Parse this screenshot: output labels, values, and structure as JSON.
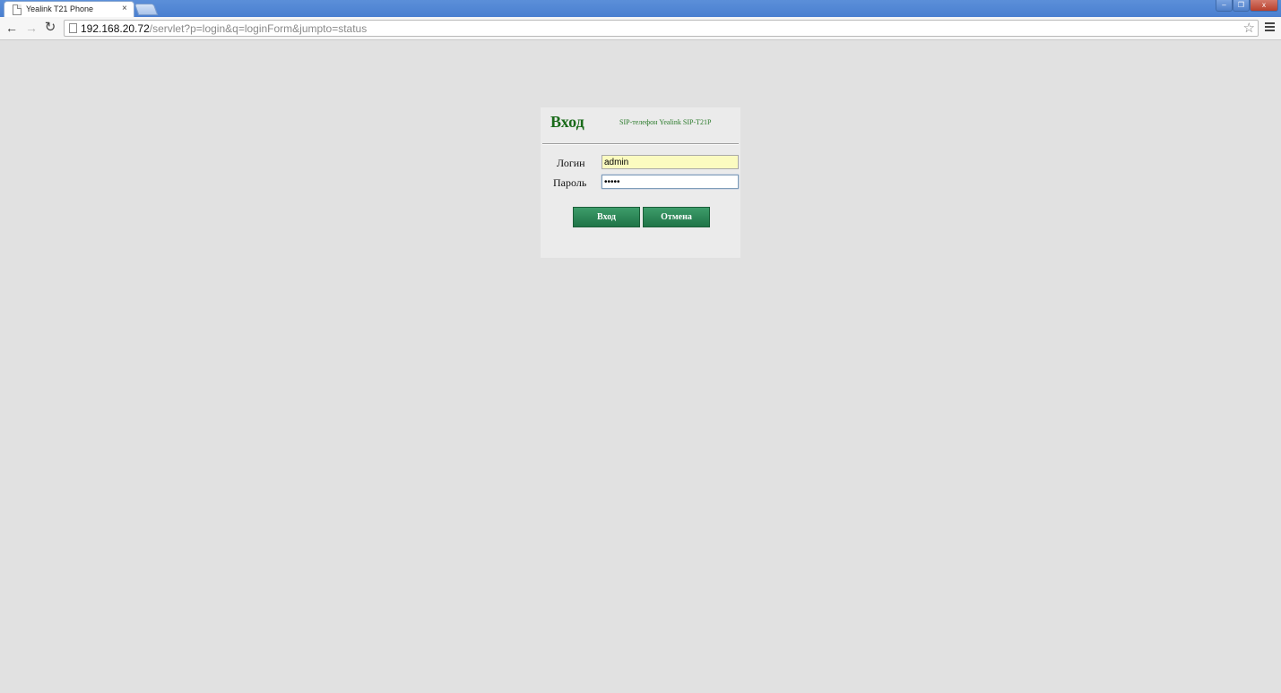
{
  "browser": {
    "tab_title": "Yealink T21 Phone",
    "tab_close": "×",
    "url_host": "192.168.20.72",
    "url_path": "/servlet?p=login&q=loginForm&jumpto=status",
    "back_icon": "←",
    "forward_icon": "→",
    "reload_icon": "↻",
    "star_icon": "☆",
    "window_buttons": {
      "minimize": "–",
      "maximize": "❐",
      "close": "x"
    }
  },
  "login_panel": {
    "title": "Вход",
    "subtitle": "SIP-телефон Yealink SIP-T21P",
    "username_label": "Логин",
    "username_value": "admin",
    "password_label": "Пароль",
    "password_value": "•••••",
    "login_button": "Вход",
    "cancel_button": "Отмена"
  },
  "colors": {
    "page_background": "#e1e1e1",
    "panel_background": "#ebebeb",
    "title_green": "#1a6b1a",
    "button_green": "#2b8a57",
    "username_field_bg": "#fbfbc0"
  }
}
